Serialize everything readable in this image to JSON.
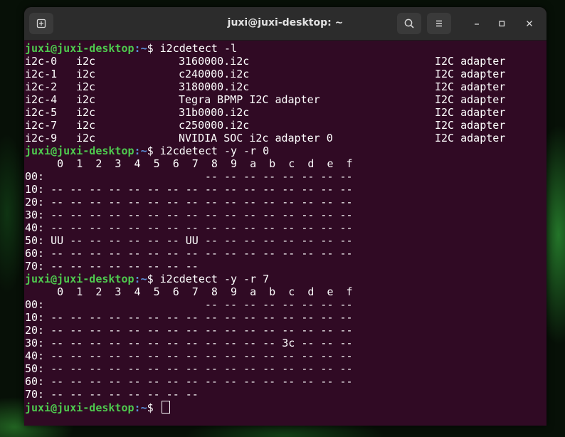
{
  "window": {
    "title": "juxi@juxi-desktop: ~"
  },
  "titlebar": {
    "icons": {
      "new_tab": "new-tab-icon",
      "search": "search-icon",
      "menu": "hamburger-menu-icon",
      "minimize": "minimize-icon",
      "maximize": "maximize-icon",
      "close": "close-icon"
    }
  },
  "colors": {
    "terminal_bg": "#300a24",
    "prompt_user": "#4ec94e",
    "prompt_path": "#5b8fd8",
    "text": "#ffffff",
    "titlebar_bg": "#2c2c2c"
  },
  "prompt": {
    "user_host": "juxi@juxi-desktop",
    "sep": ":",
    "path": "~",
    "symbol": "$"
  },
  "commands": {
    "cmd1": "i2cdetect -l",
    "cmd2": "i2cdetect -y -r 0",
    "cmd3": "i2cdetect -y -r 7"
  },
  "adapters": [
    {
      "bus": "i2c-0",
      "type": "i2c",
      "name": "3160000.i2c",
      "desc": "I2C adapter"
    },
    {
      "bus": "i2c-1",
      "type": "i2c",
      "name": "c240000.i2c",
      "desc": "I2C adapter"
    },
    {
      "bus": "i2c-2",
      "type": "i2c",
      "name": "3180000.i2c",
      "desc": "I2C adapter"
    },
    {
      "bus": "i2c-4",
      "type": "i2c",
      "name": "Tegra BPMP I2C adapter",
      "desc": "I2C adapter"
    },
    {
      "bus": "i2c-5",
      "type": "i2c",
      "name": "31b0000.i2c",
      "desc": "I2C adapter"
    },
    {
      "bus": "i2c-7",
      "type": "i2c",
      "name": "c250000.i2c",
      "desc": "I2C adapter"
    },
    {
      "bus": "i2c-9",
      "type": "i2c",
      "name": "NVIDIA SOC i2c adapter 0",
      "desc": "I2C adapter"
    }
  ],
  "scan0": {
    "header": "     0  1  2  3  4  5  6  7  8  9  a  b  c  d  e  f",
    "rows": [
      "00:                         -- -- -- -- -- -- -- --",
      "10: -- -- -- -- -- -- -- -- -- -- -- -- -- -- -- --",
      "20: -- -- -- -- -- -- -- -- -- -- -- -- -- -- -- --",
      "30: -- -- -- -- -- -- -- -- -- -- -- -- -- -- -- --",
      "40: -- -- -- -- -- -- -- -- -- -- -- -- -- -- -- --",
      "50: UU -- -- -- -- -- -- UU -- -- -- -- -- -- -- --",
      "60: -- -- -- -- -- -- -- -- -- -- -- -- -- -- -- --",
      "70: -- -- -- -- -- -- -- --"
    ]
  },
  "scan7": {
    "header": "     0  1  2  3  4  5  6  7  8  9  a  b  c  d  e  f",
    "rows": [
      "00:                         -- -- -- -- -- -- -- --",
      "10: -- -- -- -- -- -- -- -- -- -- -- -- -- -- -- --",
      "20: -- -- -- -- -- -- -- -- -- -- -- -- -- -- -- --",
      "30: -- -- -- -- -- -- -- -- -- -- -- -- 3c -- -- --",
      "40: -- -- -- -- -- -- -- -- -- -- -- -- -- -- -- --",
      "50: -- -- -- -- -- -- -- -- -- -- -- -- -- -- -- --",
      "60: -- -- -- -- -- -- -- -- -- -- -- -- -- -- -- --",
      "70: -- -- -- -- -- -- -- --"
    ]
  }
}
